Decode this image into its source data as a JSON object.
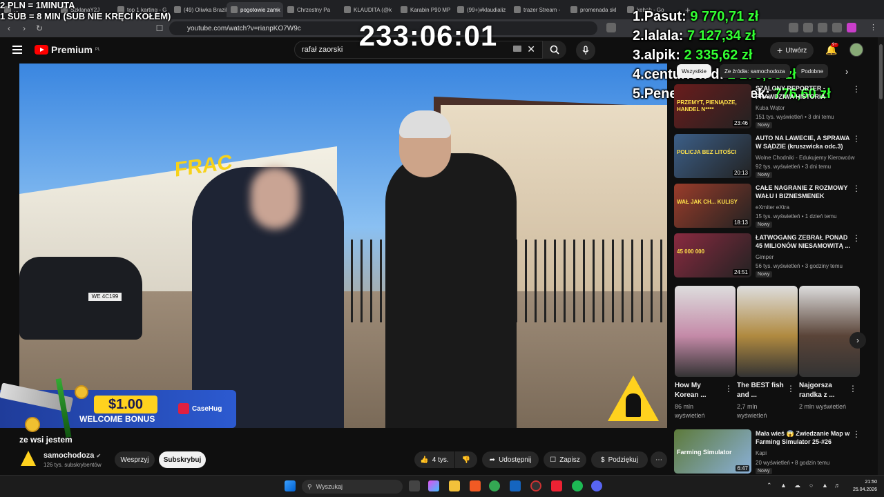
{
  "browser": {
    "tabs": [
      "...",
      "SzklanaY2J",
      "top 1 karting - G",
      "(49) Oliwka Brazil",
      "pogotowie zamk",
      "Chrzestny Pa",
      "KLAUDITA (@k",
      "Karabin P90 MP",
      "(99+)#klaudializ",
      "trazer Stream -",
      "promenada skl",
      "kebab - Go"
    ],
    "url": "youtube.com/watch?v=rianpKO7W9c"
  },
  "overlay": {
    "rate_line1": "2 PLN = 1MINUTA",
    "rate_line2": "1 SUB = 8 MIN (SUB NIE KRĘCI KOŁEM)",
    "timer": "233:06:01",
    "leaderboard": [
      {
        "rank": "1.",
        "name": "Pasut:",
        "amount": "9 770,71 zł"
      },
      {
        "rank": "2.",
        "name": "lalala:",
        "amount": "7 127,34 zł"
      },
      {
        "rank": "3.",
        "name": "alpik:",
        "amount": "2 335,62 zł"
      },
      {
        "rank": "4.",
        "name": "centurion d:",
        "amount": "2 173,08 zł"
      },
      {
        "rank": "5.",
        "name": "Penetrator dziurek:",
        "amount": "776,60 zł"
      }
    ]
  },
  "youtube": {
    "logo": "Premium",
    "logo_region": "PL",
    "search_value": "rafał zaorski",
    "create_label": "Utwórz",
    "notif_count": "9+",
    "chips": [
      "Wszystkie",
      "Ze źródła: samochodoza",
      "Podobne"
    ]
  },
  "video": {
    "sign_text": "FRAC",
    "plate": "WE 4C199",
    "bonus_amount": "$1.00",
    "bonus_text": "WELCOME BONUS",
    "bonus_brand": "CaseHug",
    "caption": "ze wsi jestem",
    "channel_name": "samochodoza",
    "channel_subs": "126 tys. subskrybentów",
    "support_label": "Wesprzyj",
    "subscribe_label": "Subskrybuj",
    "likes": "4 tys.",
    "share_label": "Udostępnij",
    "save_label": "Zapisz",
    "thanks_label": "Podziękuj"
  },
  "recommendations": [
    {
      "title": "SZALONY REPORTER - PRAWDZIWA HISTORIA",
      "channel": "Kuba Wątor",
      "meta": "151 tys. wyświetleń • 3 dni temu",
      "badge": "Nowy",
      "duration": "23:46",
      "thumb_text": "PRZEMYT, PIENIĄDZE, HANDEL N****",
      "color": "#6a1c1c"
    },
    {
      "title": "AUTO NA LAWECIE, A SPRAWA W SĄDZIE (kruszwicka odc.3)",
      "channel": "Wolne Chodniki - Edukujemy Kierowców",
      "meta": "92 tys. wyświetleń • 3 dni temu",
      "badge": "Nowy",
      "duration": "20:13",
      "thumb_text": "POLICJA BEZ LITOŚCI",
      "color": "#3c5f88"
    },
    {
      "title": "CAŁE NAGRANIE Z ROZMOWY WAŁU I BIZNESMENEK",
      "channel": "eXmiter eXtra",
      "meta": "15 tys. wyświetleń • 1 dzień temu",
      "badge": "Nowy",
      "duration": "18:13",
      "thumb_text": "WAŁ JAK CH... KULISY",
      "color": "#9a3c2a"
    },
    {
      "title": "ŁATWOGANG ZEBRAŁ PONAD 45 MILIONÓW NIESAMOWITĄ ...",
      "channel": "Gimper",
      "meta": "56 tys. wyświetleń • 3 godziny temu",
      "badge": "Nowy",
      "duration": "24:51",
      "thumb_text": "45 000 000",
      "color": "#8a2a40"
    }
  ],
  "shorts": [
    {
      "title": "How My Korean ...",
      "views": "86 mln wyświetleń",
      "color": "#c48aa8"
    },
    {
      "title": "The BEST fish and ...",
      "views": "2,7 mln wyświetleń",
      "color": "#b08a40"
    },
    {
      "title": "Najgorsza randka z ...",
      "views": "2 mln wyświetleń",
      "color": "#5a4438"
    }
  ],
  "rec_last": {
    "title": "Mała wieś 😱 Zwiedzanie Map w Farming Simulator 25-#26",
    "channel": "Kapi",
    "meta": "20 wyświetleń • 8 godzin temu",
    "badge": "Nowy",
    "duration": "6:47",
    "thumb_text": "Farming Simulator",
    "color": "#5d7a3a"
  },
  "taskbar": {
    "search_placeholder": "Wyszukaj",
    "time": "21:50",
    "date": "25.04.2026"
  }
}
